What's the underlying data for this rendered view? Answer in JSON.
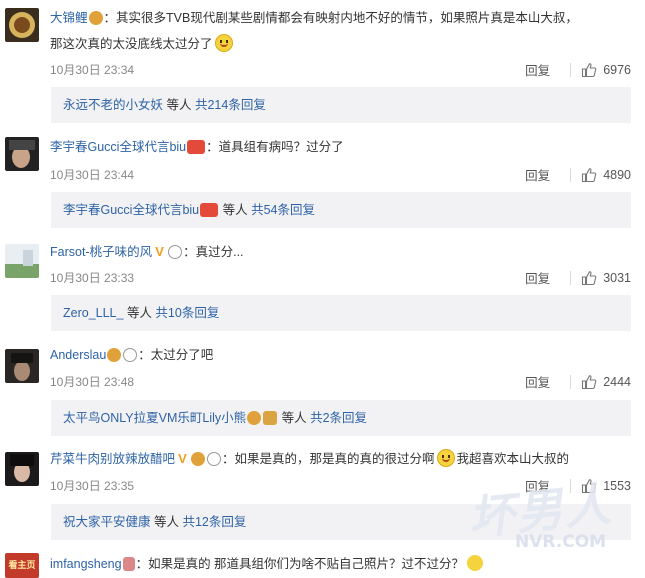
{
  "comments": [
    {
      "user": "大锦鲤",
      "text_line1": "：其实很多TVB现代剧某些剧情都会有映射内地不好的情节，如果照片真是本山大叔，",
      "text_line2": "那这次真的太没底线太过分了",
      "time": "10月30日 23:34",
      "reply_label": "回复",
      "likes": "6976",
      "sub": {
        "user": "永远不老的小女妖",
        "middle": " 等人 ",
        "count": "共214条回复"
      }
    },
    {
      "user": "李宇春Gucci全球代言biu",
      "text_line1": "：道具组有病吗？过分了",
      "time": "10月30日 23:44",
      "reply_label": "回复",
      "likes": "4890",
      "sub": {
        "user": "李宇春Gucci全球代言biu",
        "middle": " 等人 ",
        "count": "共54条回复"
      }
    },
    {
      "user": "Farsot-桃子味的风",
      "text_line1": "：真过分...",
      "time": "10月30日 23:33",
      "reply_label": "回复",
      "likes": "3031",
      "sub": {
        "user": "Zero_LLL_",
        "middle": " 等人 ",
        "count": "共10条回复"
      }
    },
    {
      "user": "Anderslau",
      "text_line1": "：太过分了吧",
      "time": "10月30日 23:48",
      "reply_label": "回复",
      "likes": "2444",
      "sub": {
        "user": "太平鸟ONLY拉夏VM乐町Lily小熊",
        "middle": " 等人 ",
        "count": "共2条回复"
      }
    },
    {
      "user": "芹菜牛肉别放辣放醋吧",
      "text_line1": "：如果是真的，那是真的真的很过分啊",
      "text_line1b": "我超喜欢本山大叔的",
      "time": "10月30日 23:35",
      "reply_label": "回复",
      "likes": "1553",
      "sub": {
        "user": "祝大家平安健康",
        "middle": " 等人 ",
        "count": "共12条回复"
      }
    },
    {
      "user": "imfangsheng",
      "text_line1": "：如果是真的 那道具组你们为啥不贴自己照片？过不过分？",
      "avatar_text": "看主页"
    }
  ],
  "watermark": {
    "main": "坏男人",
    "url": "NVR.COM"
  },
  "icons": {
    "like": "thumbs-up-icon",
    "smile": "smile-emoji-icon",
    "verified": "verified-v-icon"
  },
  "colors": {
    "link": "#2e63a6",
    "subbox_bg": "#f2f2f5",
    "time": "#888888"
  }
}
